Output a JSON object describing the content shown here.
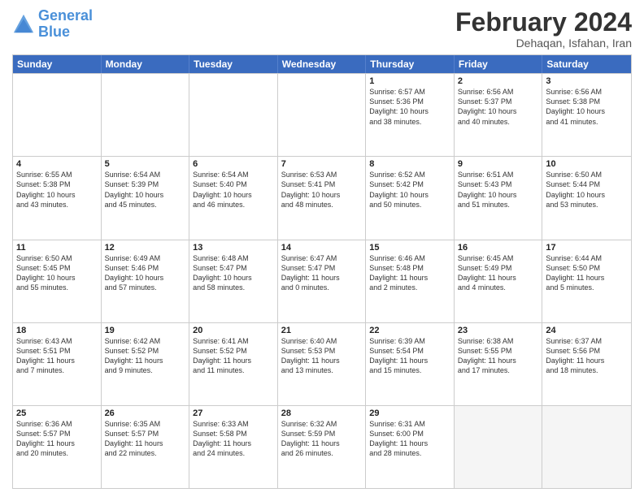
{
  "header": {
    "logo_line1": "General",
    "logo_line2": "Blue",
    "month_title": "February 2024",
    "subtitle": "Dehaqan, Isfahan, Iran"
  },
  "weekdays": [
    "Sunday",
    "Monday",
    "Tuesday",
    "Wednesday",
    "Thursday",
    "Friday",
    "Saturday"
  ],
  "rows": [
    [
      {
        "day": "",
        "lines": []
      },
      {
        "day": "",
        "lines": []
      },
      {
        "day": "",
        "lines": []
      },
      {
        "day": "",
        "lines": []
      },
      {
        "day": "1",
        "lines": [
          "Sunrise: 6:57 AM",
          "Sunset: 5:36 PM",
          "Daylight: 10 hours",
          "and 38 minutes."
        ]
      },
      {
        "day": "2",
        "lines": [
          "Sunrise: 6:56 AM",
          "Sunset: 5:37 PM",
          "Daylight: 10 hours",
          "and 40 minutes."
        ]
      },
      {
        "day": "3",
        "lines": [
          "Sunrise: 6:56 AM",
          "Sunset: 5:38 PM",
          "Daylight: 10 hours",
          "and 41 minutes."
        ]
      }
    ],
    [
      {
        "day": "4",
        "lines": [
          "Sunrise: 6:55 AM",
          "Sunset: 5:38 PM",
          "Daylight: 10 hours",
          "and 43 minutes."
        ]
      },
      {
        "day": "5",
        "lines": [
          "Sunrise: 6:54 AM",
          "Sunset: 5:39 PM",
          "Daylight: 10 hours",
          "and 45 minutes."
        ]
      },
      {
        "day": "6",
        "lines": [
          "Sunrise: 6:54 AM",
          "Sunset: 5:40 PM",
          "Daylight: 10 hours",
          "and 46 minutes."
        ]
      },
      {
        "day": "7",
        "lines": [
          "Sunrise: 6:53 AM",
          "Sunset: 5:41 PM",
          "Daylight: 10 hours",
          "and 48 minutes."
        ]
      },
      {
        "day": "8",
        "lines": [
          "Sunrise: 6:52 AM",
          "Sunset: 5:42 PM",
          "Daylight: 10 hours",
          "and 50 minutes."
        ]
      },
      {
        "day": "9",
        "lines": [
          "Sunrise: 6:51 AM",
          "Sunset: 5:43 PM",
          "Daylight: 10 hours",
          "and 51 minutes."
        ]
      },
      {
        "day": "10",
        "lines": [
          "Sunrise: 6:50 AM",
          "Sunset: 5:44 PM",
          "Daylight: 10 hours",
          "and 53 minutes."
        ]
      }
    ],
    [
      {
        "day": "11",
        "lines": [
          "Sunrise: 6:50 AM",
          "Sunset: 5:45 PM",
          "Daylight: 10 hours",
          "and 55 minutes."
        ]
      },
      {
        "day": "12",
        "lines": [
          "Sunrise: 6:49 AM",
          "Sunset: 5:46 PM",
          "Daylight: 10 hours",
          "and 57 minutes."
        ]
      },
      {
        "day": "13",
        "lines": [
          "Sunrise: 6:48 AM",
          "Sunset: 5:47 PM",
          "Daylight: 10 hours",
          "and 58 minutes."
        ]
      },
      {
        "day": "14",
        "lines": [
          "Sunrise: 6:47 AM",
          "Sunset: 5:47 PM",
          "Daylight: 11 hours",
          "and 0 minutes."
        ]
      },
      {
        "day": "15",
        "lines": [
          "Sunrise: 6:46 AM",
          "Sunset: 5:48 PM",
          "Daylight: 11 hours",
          "and 2 minutes."
        ]
      },
      {
        "day": "16",
        "lines": [
          "Sunrise: 6:45 AM",
          "Sunset: 5:49 PM",
          "Daylight: 11 hours",
          "and 4 minutes."
        ]
      },
      {
        "day": "17",
        "lines": [
          "Sunrise: 6:44 AM",
          "Sunset: 5:50 PM",
          "Daylight: 11 hours",
          "and 5 minutes."
        ]
      }
    ],
    [
      {
        "day": "18",
        "lines": [
          "Sunrise: 6:43 AM",
          "Sunset: 5:51 PM",
          "Daylight: 11 hours",
          "and 7 minutes."
        ]
      },
      {
        "day": "19",
        "lines": [
          "Sunrise: 6:42 AM",
          "Sunset: 5:52 PM",
          "Daylight: 11 hours",
          "and 9 minutes."
        ]
      },
      {
        "day": "20",
        "lines": [
          "Sunrise: 6:41 AM",
          "Sunset: 5:52 PM",
          "Daylight: 11 hours",
          "and 11 minutes."
        ]
      },
      {
        "day": "21",
        "lines": [
          "Sunrise: 6:40 AM",
          "Sunset: 5:53 PM",
          "Daylight: 11 hours",
          "and 13 minutes."
        ]
      },
      {
        "day": "22",
        "lines": [
          "Sunrise: 6:39 AM",
          "Sunset: 5:54 PM",
          "Daylight: 11 hours",
          "and 15 minutes."
        ]
      },
      {
        "day": "23",
        "lines": [
          "Sunrise: 6:38 AM",
          "Sunset: 5:55 PM",
          "Daylight: 11 hours",
          "and 17 minutes."
        ]
      },
      {
        "day": "24",
        "lines": [
          "Sunrise: 6:37 AM",
          "Sunset: 5:56 PM",
          "Daylight: 11 hours",
          "and 18 minutes."
        ]
      }
    ],
    [
      {
        "day": "25",
        "lines": [
          "Sunrise: 6:36 AM",
          "Sunset: 5:57 PM",
          "Daylight: 11 hours",
          "and 20 minutes."
        ]
      },
      {
        "day": "26",
        "lines": [
          "Sunrise: 6:35 AM",
          "Sunset: 5:57 PM",
          "Daylight: 11 hours",
          "and 22 minutes."
        ]
      },
      {
        "day": "27",
        "lines": [
          "Sunrise: 6:33 AM",
          "Sunset: 5:58 PM",
          "Daylight: 11 hours",
          "and 24 minutes."
        ]
      },
      {
        "day": "28",
        "lines": [
          "Sunrise: 6:32 AM",
          "Sunset: 5:59 PM",
          "Daylight: 11 hours",
          "and 26 minutes."
        ]
      },
      {
        "day": "29",
        "lines": [
          "Sunrise: 6:31 AM",
          "Sunset: 6:00 PM",
          "Daylight: 11 hours",
          "and 28 minutes."
        ]
      },
      {
        "day": "",
        "lines": []
      },
      {
        "day": "",
        "lines": []
      }
    ]
  ]
}
